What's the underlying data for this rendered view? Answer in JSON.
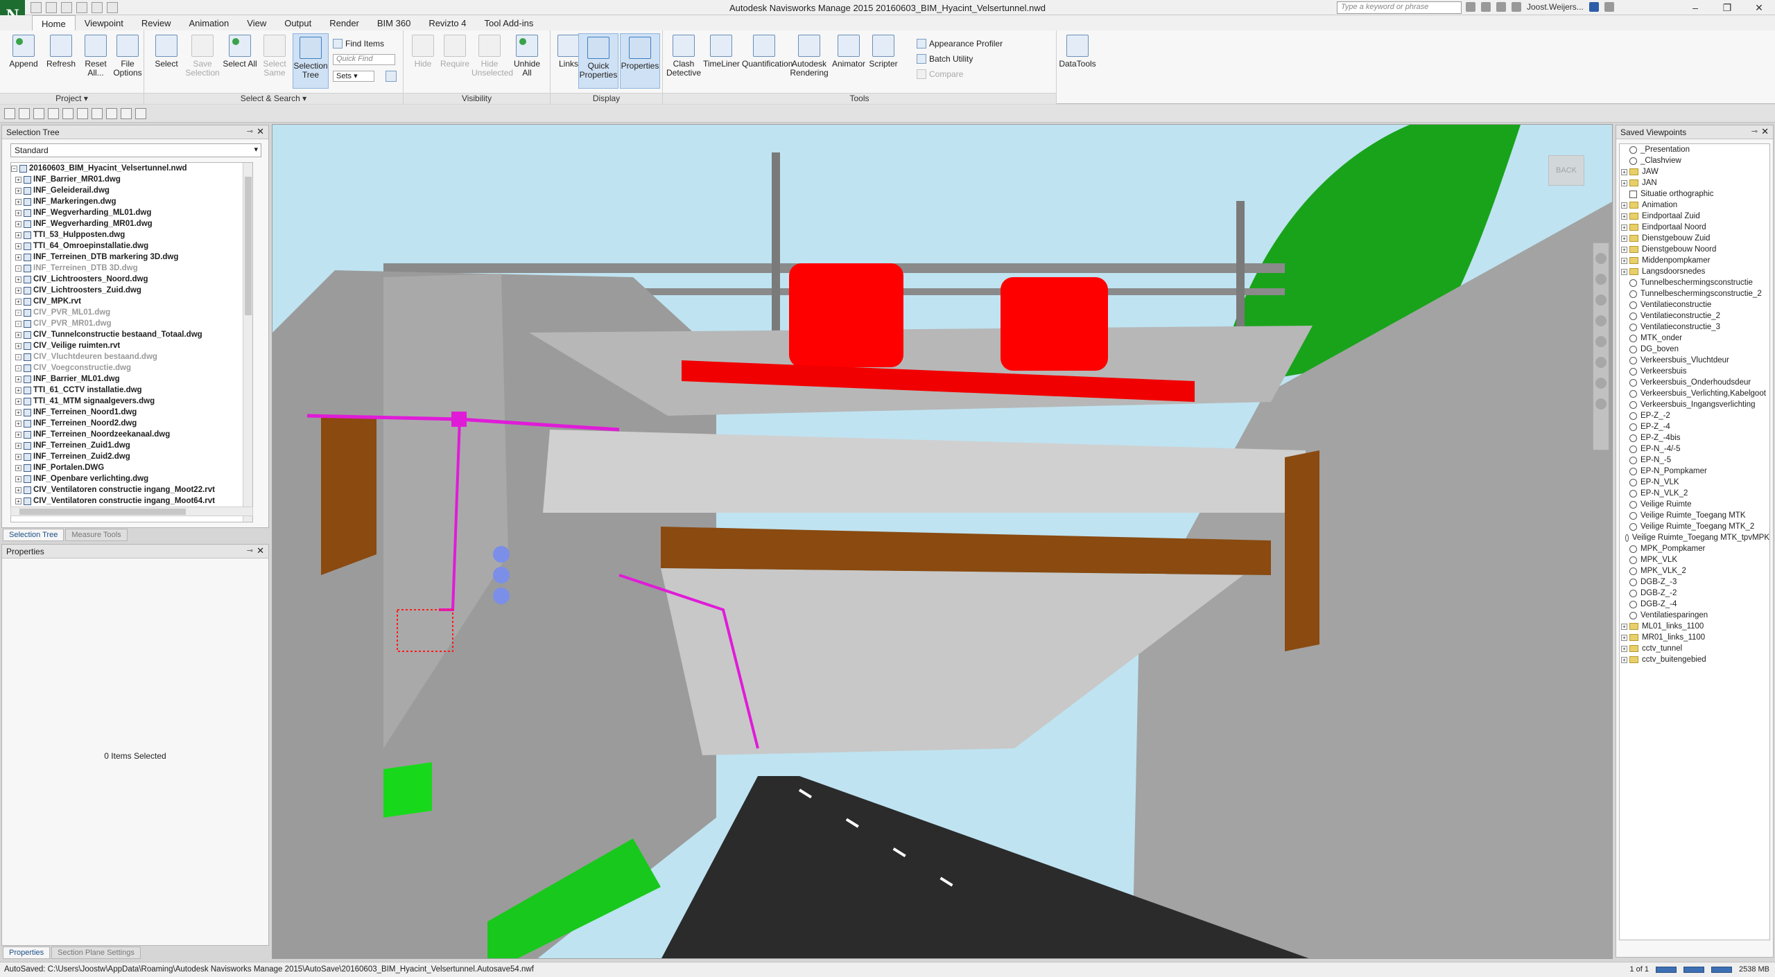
{
  "app": {
    "logo_letter": "N",
    "window_title": "Autodesk Navisworks Manage 2015   20160603_BIM_Hyacint_Velsertunnel.nwd",
    "search_placeholder": "Type a keyword or phrase",
    "user_name": "Joost.Weijers...",
    "controls": {
      "minimize": "–",
      "maximize": "❐",
      "close": "✕"
    }
  },
  "ribbon_tabs": [
    "Home",
    "Viewpoint",
    "Review",
    "Animation",
    "View",
    "Output",
    "Render",
    "BIM 360",
    "Revizto 4",
    "Tool Add-ins"
  ],
  "ribbon": {
    "project": {
      "label": "Project ▾",
      "buttons": [
        "Append",
        "Refresh",
        "Reset All...",
        "File Options"
      ]
    },
    "select_search": {
      "label": "Select & Search ▾",
      "buttons": [
        "Select",
        "Save Selection",
        "Select All",
        "Select Same",
        "Selection Tree"
      ],
      "find_items": "Find Items",
      "quick_find_placeholder": "Quick Find",
      "sets": "Sets"
    },
    "visibility": {
      "label": "Visibility",
      "buttons": [
        "Hide",
        "Require",
        "Hide Unselected",
        "Unhide All"
      ]
    },
    "display": {
      "label": "Display",
      "buttons": [
        "Links",
        "Quick Properties",
        "Properties"
      ]
    },
    "tools": {
      "label": "Tools",
      "buttons": [
        "Clash Detective",
        "TimeLiner",
        "Quantification",
        "Autodesk Rendering",
        "Animator",
        "Scripter"
      ],
      "appearance_profiler": "Appearance Profiler",
      "batch_utility": "Batch Utility",
      "compare": "Compare"
    },
    "datatools": {
      "buttons": [
        "DataTools"
      ]
    }
  },
  "selection_tree": {
    "title": "Selection Tree",
    "mode": "Standard",
    "items": [
      {
        "name": "20160603_BIM_Hyacint_Velsertunnel.nwd",
        "hidden": false,
        "root": true
      },
      {
        "name": "INF_Barrier_MR01.dwg",
        "hidden": false
      },
      {
        "name": "INF_Geleiderail.dwg",
        "hidden": false
      },
      {
        "name": "INF_Markeringen.dwg",
        "hidden": false
      },
      {
        "name": "INF_Wegverharding_ML01.dwg",
        "hidden": false
      },
      {
        "name": "INF_Wegverharding_MR01.dwg",
        "hidden": false
      },
      {
        "name": "TTI_53_Hulpposten.dwg",
        "hidden": false
      },
      {
        "name": "TTI_64_Omroepinstallatie.dwg",
        "hidden": false
      },
      {
        "name": "INF_Terreinen_DTB markering 3D.dwg",
        "hidden": false
      },
      {
        "name": "INF_Terreinen_DTB 3D.dwg",
        "hidden": true
      },
      {
        "name": "CIV_Lichtroosters_Noord.dwg",
        "hidden": false
      },
      {
        "name": "CIV_Lichtroosters_Zuid.dwg",
        "hidden": false
      },
      {
        "name": "CIV_MPK.rvt",
        "hidden": false
      },
      {
        "name": "CIV_PVR_ML01.dwg",
        "hidden": true
      },
      {
        "name": "CIV_PVR_MR01.dwg",
        "hidden": true
      },
      {
        "name": "CIV_Tunnelconstructie bestaand_Totaal.dwg",
        "hidden": false
      },
      {
        "name": "CIV_Veilige ruimten.rvt",
        "hidden": false
      },
      {
        "name": "CIV_Vluchtdeuren bestaand.dwg",
        "hidden": true
      },
      {
        "name": "CIV_Voegconstructie.dwg",
        "hidden": true
      },
      {
        "name": "INF_Barrier_ML01.dwg",
        "hidden": false
      },
      {
        "name": "TTI_61_CCTV installatie.dwg",
        "hidden": false
      },
      {
        "name": "TTI_41_MTM signaalgevers.dwg",
        "hidden": false
      },
      {
        "name": "INF_Terreinen_Noord1.dwg",
        "hidden": false
      },
      {
        "name": "INF_Terreinen_Noord2.dwg",
        "hidden": false
      },
      {
        "name": "INF_Terreinen_Noordzeekanaal.dwg",
        "hidden": false
      },
      {
        "name": "INF_Terreinen_Zuid1.dwg",
        "hidden": false
      },
      {
        "name": "INF_Terreinen_Zuid2.dwg",
        "hidden": false
      },
      {
        "name": "INF_Portalen.DWG",
        "hidden": false
      },
      {
        "name": "INF_Openbare verlichting.dwg",
        "hidden": false
      },
      {
        "name": "CIV_Ventilatoren constructie ingang_Moot22.rvt",
        "hidden": false
      },
      {
        "name": "CIV_Ventilatoren constructie ingang_Moot64.rvt",
        "hidden": false
      }
    ],
    "tabs": [
      "Selection Tree",
      "Measure Tools"
    ]
  },
  "properties": {
    "title": "Properties",
    "empty_text": "0 Items Selected",
    "tabs": [
      "Properties",
      "Section Plane Settings"
    ]
  },
  "viewport": {
    "viewcube_label": "BACK"
  },
  "saved_viewpoints": {
    "title": "Saved Viewpoints",
    "items": [
      {
        "name": "_Presentation",
        "kind": "view",
        "expand": false
      },
      {
        "name": "_Clashview",
        "kind": "view",
        "expand": false
      },
      {
        "name": "JAW",
        "kind": "folder",
        "expand": true
      },
      {
        "name": "JAN",
        "kind": "folder",
        "expand": true
      },
      {
        "name": "Situatie orthographic",
        "kind": "ortho",
        "expand": false
      },
      {
        "name": "Animation",
        "kind": "folder",
        "expand": true
      },
      {
        "name": "Eindportaal Zuid",
        "kind": "folder",
        "expand": true
      },
      {
        "name": "Eindportaal Noord",
        "kind": "folder",
        "expand": true
      },
      {
        "name": "Dienstgebouw Zuid",
        "kind": "folder",
        "expand": true
      },
      {
        "name": "Dienstgebouw Noord",
        "kind": "folder",
        "expand": true
      },
      {
        "name": "Middenpompkamer",
        "kind": "folder",
        "expand": true
      },
      {
        "name": "Langsdoorsnedes",
        "kind": "folder",
        "expand": true
      },
      {
        "name": "Tunnelbeschermingsconstructie",
        "kind": "view",
        "expand": false
      },
      {
        "name": "Tunnelbeschermingsconstructie_2",
        "kind": "view",
        "expand": false
      },
      {
        "name": "Ventilatieconstructie",
        "kind": "view",
        "expand": false
      },
      {
        "name": "Ventilatieconstructie_2",
        "kind": "view",
        "expand": false
      },
      {
        "name": "Ventilatieconstructie_3",
        "kind": "view",
        "expand": false
      },
      {
        "name": "MTK_onder",
        "kind": "view",
        "expand": false
      },
      {
        "name": "DG_boven",
        "kind": "view",
        "expand": false
      },
      {
        "name": "Verkeersbuis_Vluchtdeur",
        "kind": "view",
        "expand": false
      },
      {
        "name": "Verkeersbuis",
        "kind": "view",
        "expand": false
      },
      {
        "name": "Verkeersbuis_Onderhoudsdeur",
        "kind": "view",
        "expand": false
      },
      {
        "name": "Verkeersbuis_Verlichting,Kabelgoot",
        "kind": "view",
        "expand": false
      },
      {
        "name": "Verkeersbuis_Ingangsverlichting",
        "kind": "view",
        "expand": false
      },
      {
        "name": "EP-Z_-2",
        "kind": "view",
        "expand": false
      },
      {
        "name": "EP-Z_-4",
        "kind": "view",
        "expand": false
      },
      {
        "name": "EP-Z_-4bis",
        "kind": "view",
        "expand": false
      },
      {
        "name": "EP-N_-4/-5",
        "kind": "view",
        "expand": false
      },
      {
        "name": "EP-N_-5",
        "kind": "view",
        "expand": false
      },
      {
        "name": "EP-N_Pompkamer",
        "kind": "view",
        "expand": false
      },
      {
        "name": "EP-N_VLK",
        "kind": "view",
        "expand": false
      },
      {
        "name": "EP-N_VLK_2",
        "kind": "view",
        "expand": false
      },
      {
        "name": "Veilige Ruimte",
        "kind": "view",
        "expand": false
      },
      {
        "name": "Veilige Ruimte_Toegang MTK",
        "kind": "view",
        "expand": false
      },
      {
        "name": "Veilige Ruimte_Toegang MTK_2",
        "kind": "view",
        "expand": false
      },
      {
        "name": "Veilige Ruimte_Toegang MTK_tpvMPK",
        "kind": "view",
        "expand": false
      },
      {
        "name": "MPK_Pompkamer",
        "kind": "view",
        "expand": false
      },
      {
        "name": "MPK_VLK",
        "kind": "view",
        "expand": false
      },
      {
        "name": "MPK_VLK_2",
        "kind": "view",
        "expand": false
      },
      {
        "name": "DGB-Z_-3",
        "kind": "view",
        "expand": false
      },
      {
        "name": "DGB-Z_-2",
        "kind": "view",
        "expand": false
      },
      {
        "name": "DGB-Z_-4",
        "kind": "view",
        "expand": false
      },
      {
        "name": "Ventilatiesparingen",
        "kind": "view",
        "expand": false
      },
      {
        "name": "ML01_links_1100",
        "kind": "folder",
        "expand": true
      },
      {
        "name": "MR01_links_1100",
        "kind": "folder",
        "expand": true
      },
      {
        "name": "cctv_tunnel",
        "kind": "folder",
        "expand": true
      },
      {
        "name": "cctv_buitengebied",
        "kind": "folder",
        "expand": true
      }
    ]
  },
  "status": {
    "autosave": "AutoSaved: C:\\Users\\Joostw\\AppData\\Roaming\\Autodesk Navisworks Manage 2015\\AutoSave\\20160603_BIM_Hyacint_Velsertunnel.Autosave54.nwf",
    "page": "1 of 1",
    "memory": "2538 MB"
  },
  "colors": {
    "sky": "#bfe3f1",
    "concrete": "#9a9a9a",
    "highlight_red": "#ff0000",
    "cable_magenta": "#e01bd8",
    "timber_brown": "#8a4a10",
    "grass_green": "#18b31c",
    "road": "#2b2b2b"
  }
}
